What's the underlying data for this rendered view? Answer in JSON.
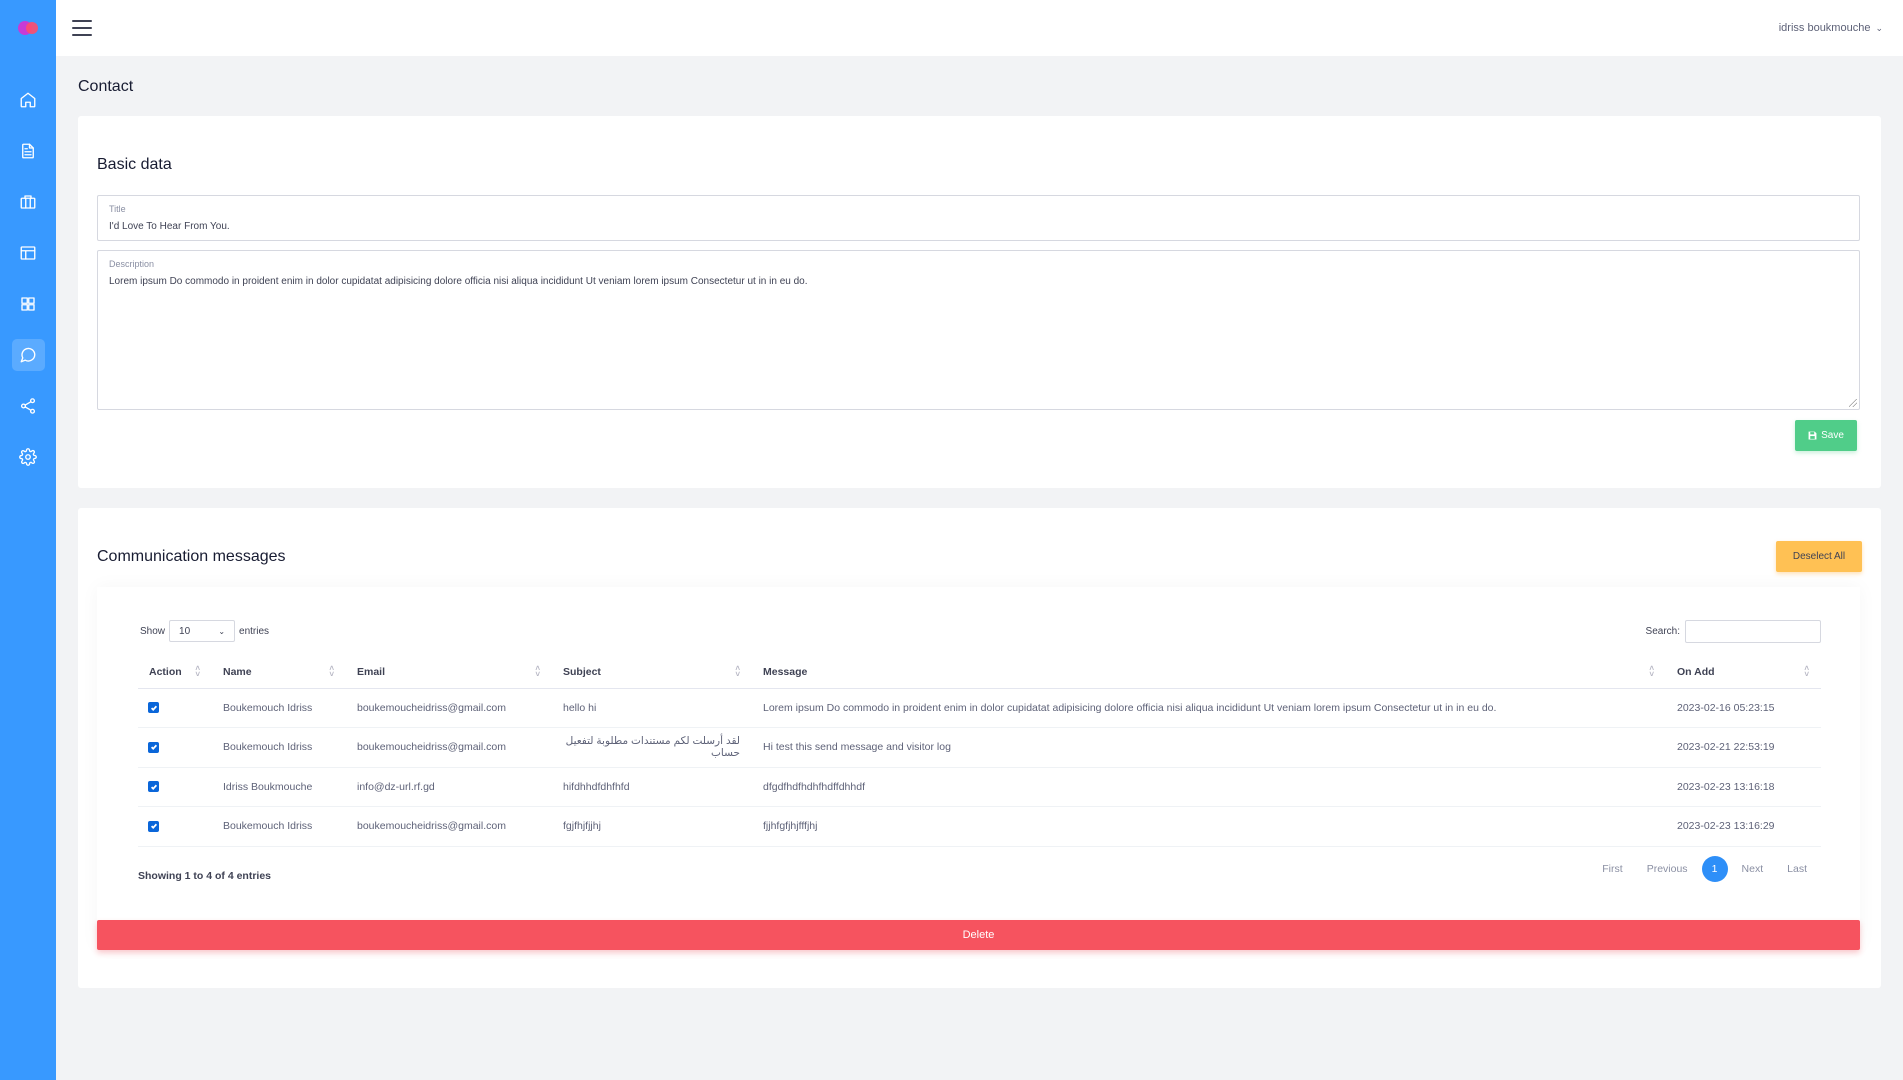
{
  "header": {
    "user_name": "idriss boukmouche"
  },
  "page": {
    "title": "Contact"
  },
  "basic": {
    "heading": "Basic data",
    "title_label": "Title",
    "title_value": "I'd Love To Hear From You.",
    "description_label": "Description",
    "description_value": "Lorem ipsum Do commodo in proident enim in dolor cupidatat adipisicing dolore officia nisi aliqua incididunt Ut veniam lorem ipsum Consectetur ut in in eu do.",
    "save_label": "Save"
  },
  "messages": {
    "heading": "Communication messages",
    "deselect_label": "Deselect All",
    "show_label": "Show",
    "entries_value": "10",
    "entries_label": "entries",
    "search_label": "Search:",
    "columns": [
      "Action",
      "Name",
      "Email",
      "Subject",
      "Message",
      "On Add"
    ],
    "rows": [
      {
        "name": "Boukemouch Idriss",
        "email": "boukemoucheidriss@gmail.com",
        "subject": "hello hi",
        "message": "Lorem ipsum Do commodo in proident enim in dolor cupidatat adipisicing dolore officia nisi aliqua incididunt Ut veniam lorem ipsum Consectetur ut in in eu do.",
        "on_add": "2023-02-16 05:23:15"
      },
      {
        "name": "Boukemouch Idriss",
        "email": "boukemoucheidriss@gmail.com",
        "subject": "لقد أرسلت لكم مستندات مطلوبة لتفعيل حساب",
        "message": "Hi test this send message and visitor log",
        "on_add": "2023-02-21 22:53:19"
      },
      {
        "name": "Idriss Boukmouche",
        "email": "info@dz-url.rf.gd",
        "subject": "hifdhhdfdhfhfd",
        "message": "dfgdfhdfhdhfhdffdhhdf",
        "on_add": "2023-02-23 13:16:18"
      },
      {
        "name": "Boukemouch Idriss",
        "email": "boukemoucheidriss@gmail.com",
        "subject": "fgjfhjfjjhj",
        "message": "fjjhfgfjhjfffjhj",
        "on_add": "2023-02-23 13:16:29"
      }
    ],
    "info": "Showing 1 to 4 of 4 entries",
    "pager": {
      "first": "First",
      "previous": "Previous",
      "current": "1",
      "next": "Next",
      "last": "Last"
    },
    "delete_label": "Delete"
  },
  "colors": {
    "sidebar": "#3899ff",
    "save": "#50cd89",
    "deselect": "#ffc154",
    "delete": "#f6535f",
    "page_active": "#2e8ff8"
  }
}
